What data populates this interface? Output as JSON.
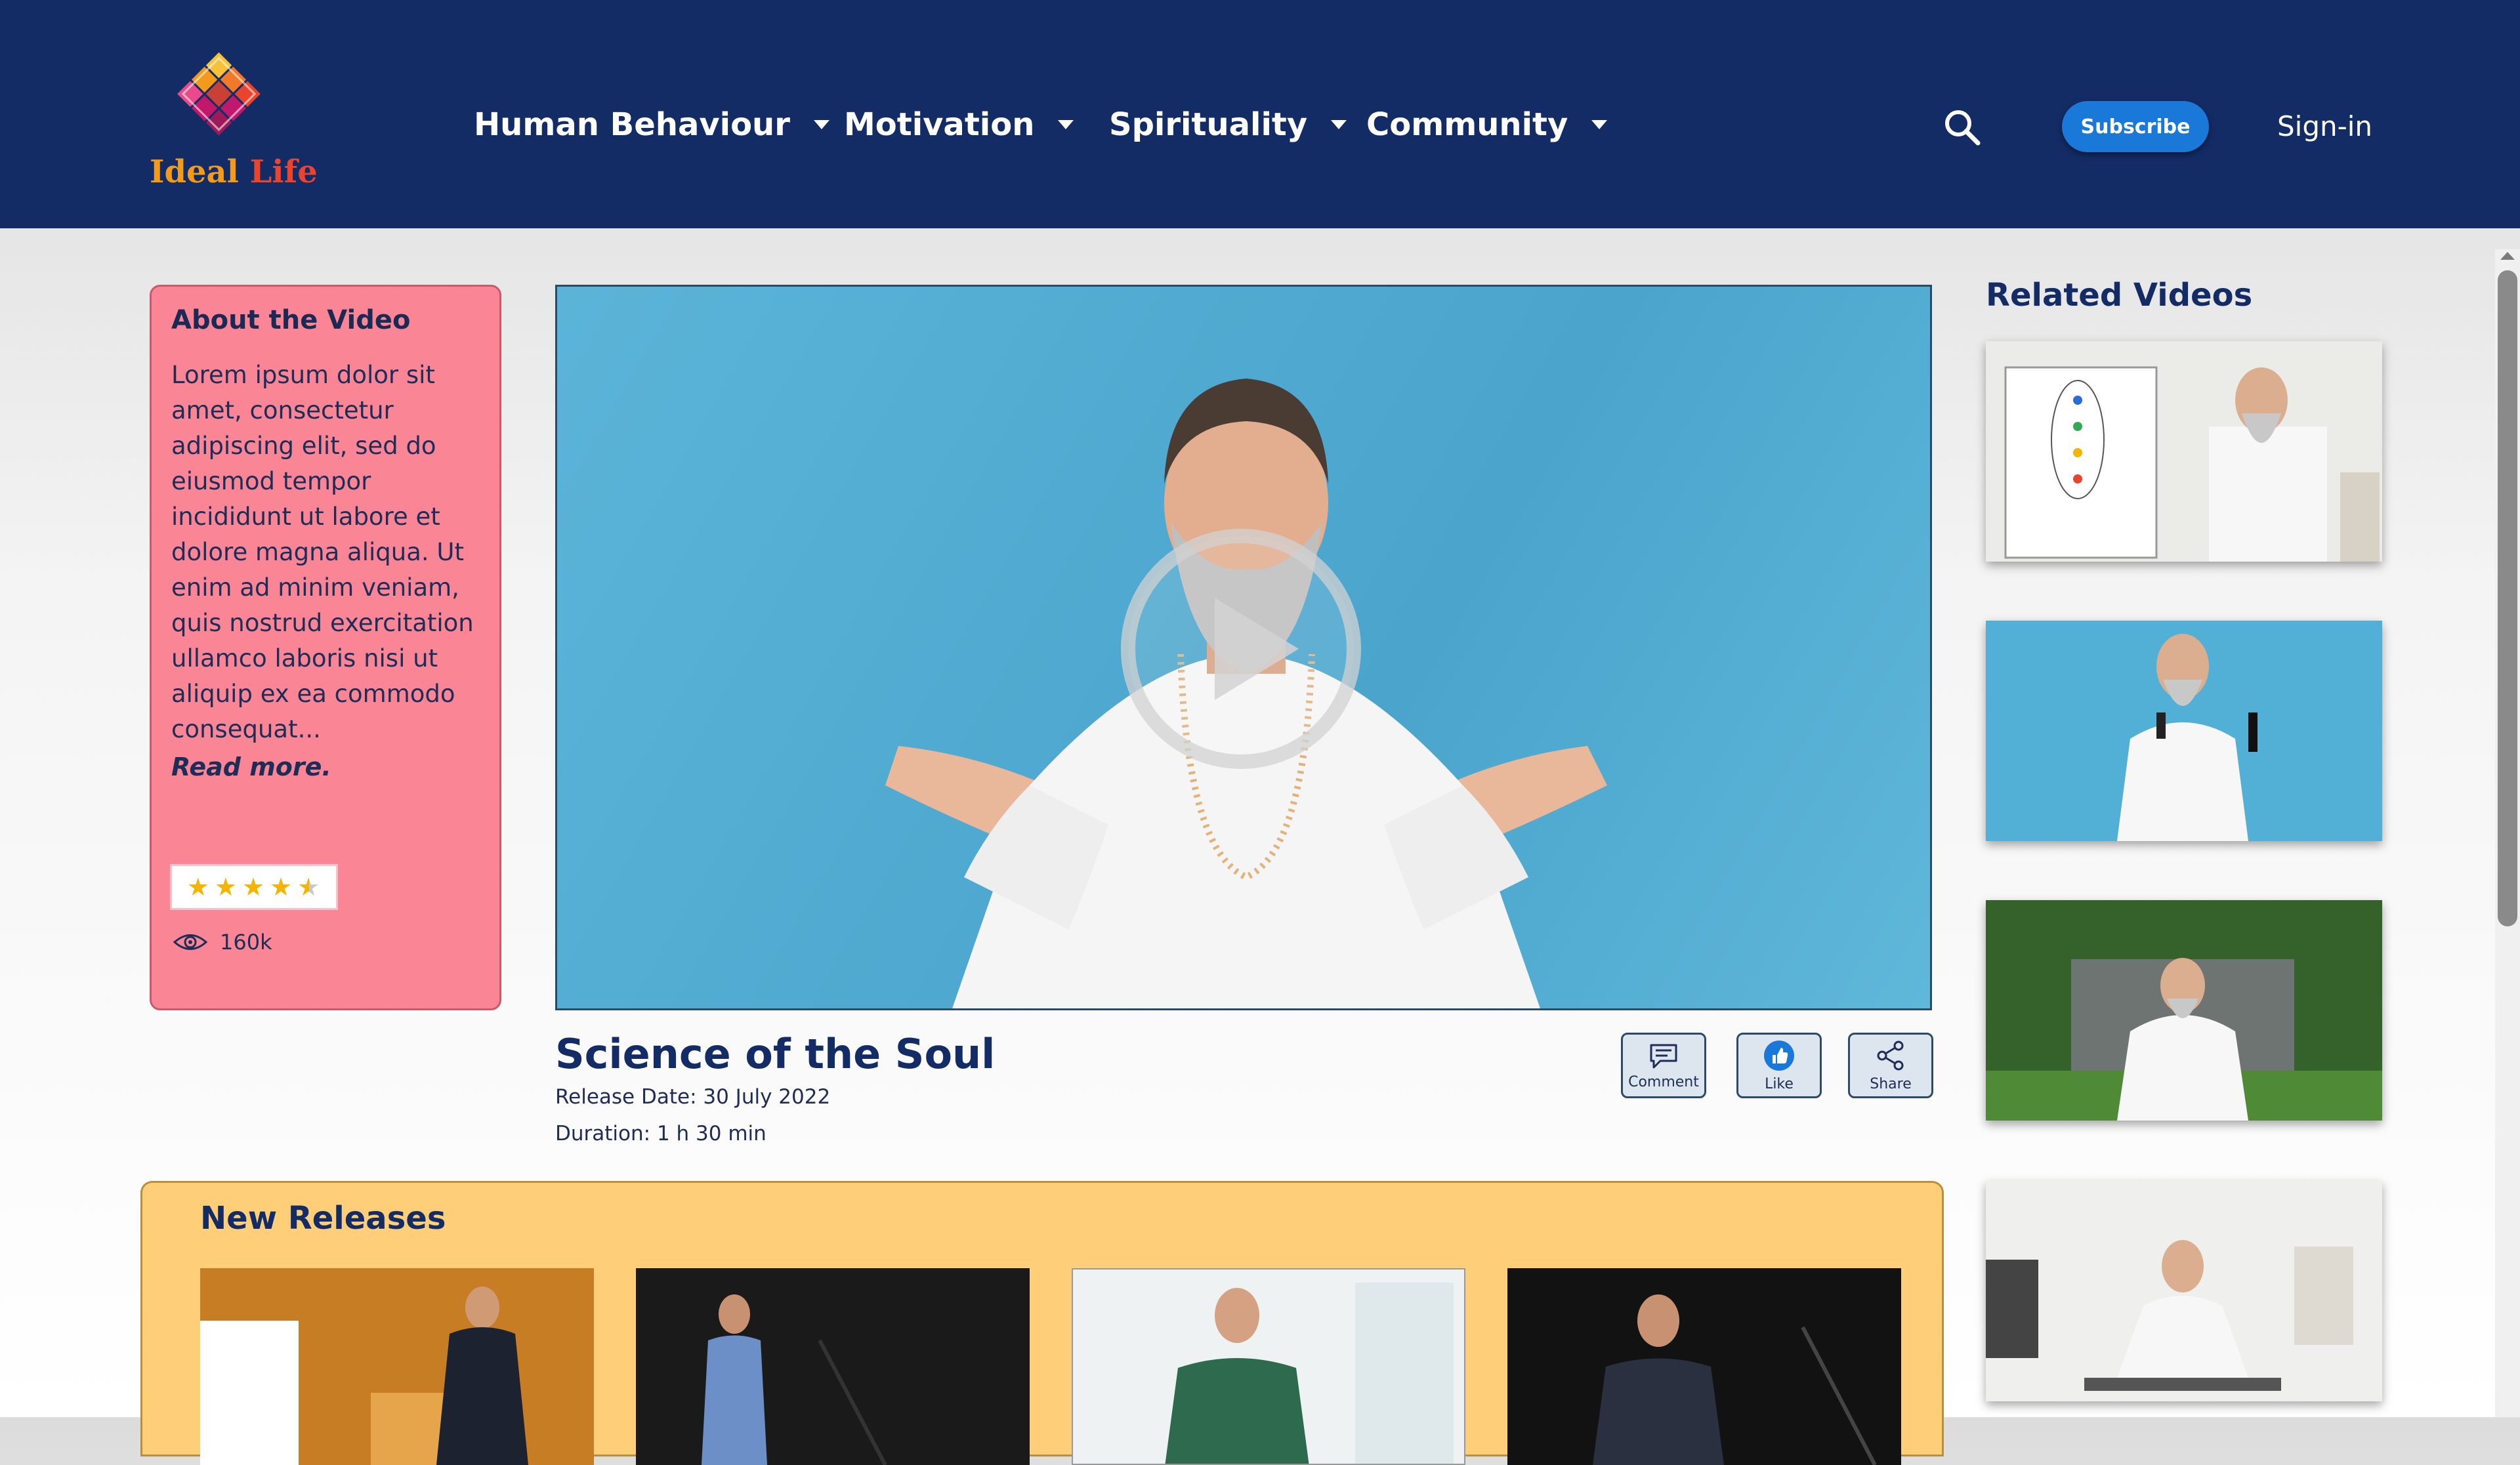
{
  "brand": {
    "word1": "Ideal",
    "word2": "Life"
  },
  "nav": {
    "items": [
      {
        "label": "Human Behaviour"
      },
      {
        "label": "Motivation"
      },
      {
        "label": "Spirituality"
      },
      {
        "label": "Community"
      }
    ],
    "subscribe_label": "Subscribe",
    "signin_label": "Sign-in"
  },
  "about": {
    "heading": "About the Video",
    "description": "Lorem ipsum dolor sit amet, consectetur adipiscing elit, sed do eiusmod tempor incididunt ut labore et dolore magna aliqua. Ut enim ad minim veniam, quis nostrud exercitation ullamco laboris nisi ut aliquip ex ea commodo consequat...",
    "read_more": "Read more.",
    "rating": 4.5,
    "rating_max": 5,
    "views": "160k"
  },
  "video": {
    "title": "Science of the Soul",
    "release_date": "Release Date: 30 July 2022",
    "duration": "Duration: 1 h 30 min",
    "actions": {
      "comment": "Comment",
      "like": "Like",
      "share": "Share"
    }
  },
  "related": {
    "heading": "Related Videos"
  },
  "new_releases": {
    "heading": "New Releases"
  },
  "colors": {
    "header_bg": "#142c66",
    "about_card": "#fa8595",
    "releases_bg": "#fece79",
    "subscribe": "#1a78d8",
    "star": "#f5b400"
  }
}
